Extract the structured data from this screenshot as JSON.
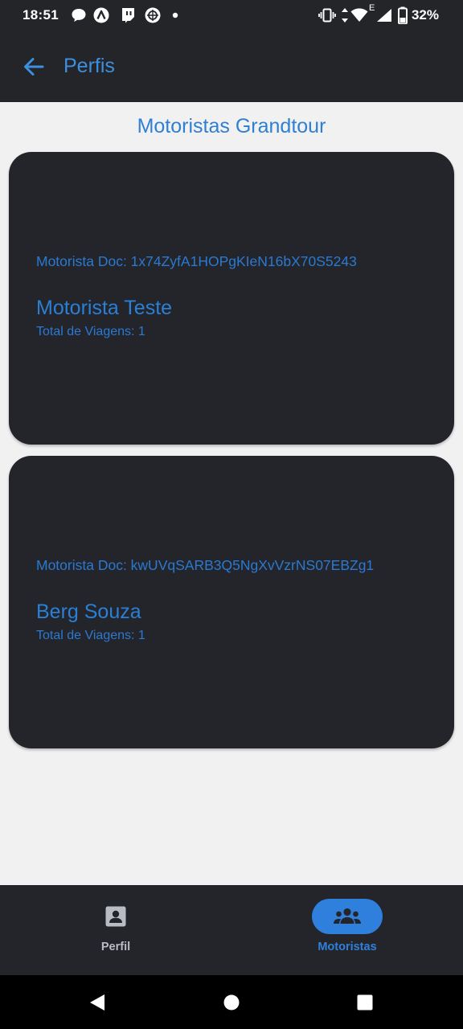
{
  "status_bar": {
    "time": "18:51",
    "battery": "32%",
    "notification_icons": [
      "chat-bubble-icon",
      "arc-logo-icon",
      "twitch-icon",
      "camera-aperture-icon",
      "dot-icon"
    ],
    "system_icons": [
      "vibrate-icon",
      "data-arrows-icon",
      "wifi-icon",
      "network-type-icon",
      "signal-icon",
      "battery-icon"
    ],
    "network_type": "E"
  },
  "app_bar": {
    "title": "Perfis",
    "back_icon": "arrow-back-icon",
    "accent": "#3d8fe0",
    "background": "#242529"
  },
  "main": {
    "section_title": "Motoristas Grandtour",
    "drivers": [
      {
        "doc": "Motorista Doc: 1x74ZyfA1HOPgKIeN16bX70S5243",
        "name": "Motorista Teste",
        "trips": "Total de Viagens: 1"
      },
      {
        "doc": "Motorista Doc: kwUVqSARB3Q5NgXvVzrNS07EBZg1",
        "name": "Berg Souza",
        "trips": "Total de Viagens: 1"
      }
    ],
    "card_color": "#24252a",
    "text_color": "#2a79d2"
  },
  "bottom_nav": {
    "items": [
      {
        "label": "Perfil",
        "icon": "contact-card-icon",
        "selected": false
      },
      {
        "label": "Motoristas",
        "icon": "group-icon",
        "selected": true
      }
    ],
    "selected_color": "#2f80dd"
  },
  "system_nav": {
    "buttons": [
      "back-triangle-icon",
      "home-circle-icon",
      "recents-square-icon"
    ]
  }
}
